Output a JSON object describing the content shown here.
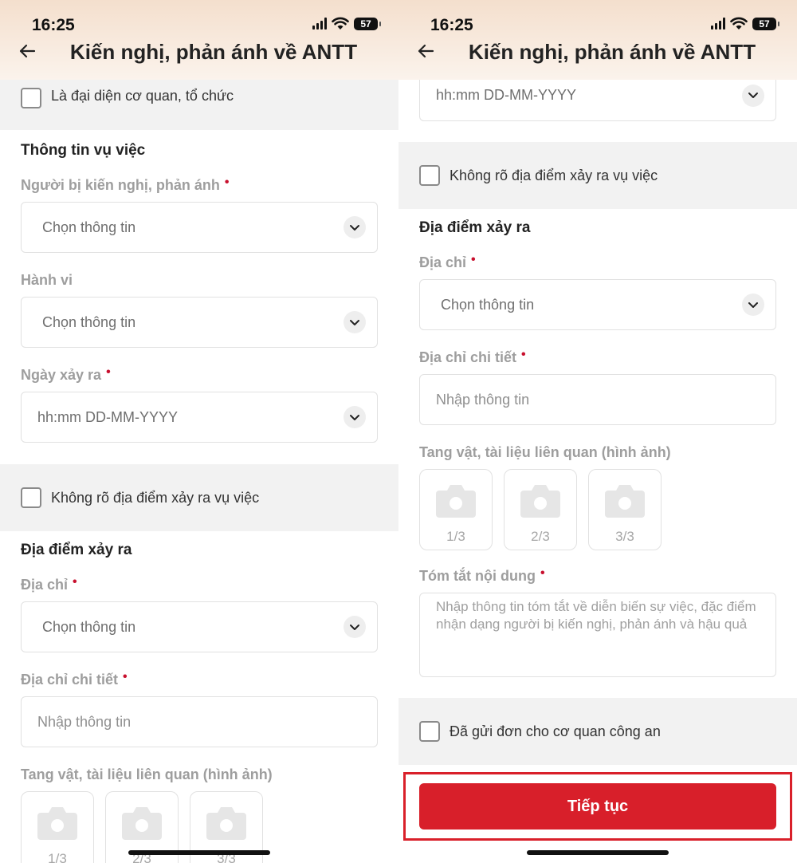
{
  "status_bar": {
    "time": "16:25",
    "battery": "57"
  },
  "header": {
    "title": "Kiến nghị, phản ánh về ANTT"
  },
  "form": {
    "representative_label": "Là đại diện cơ quan, tổ chức",
    "incident_section": "Thông tin vụ việc",
    "person_label": "Người bị kiến nghị, phản ánh",
    "behavior_label": "Hành vi",
    "date_label": "Ngày xảy ra",
    "select_placeholder": "Chọn thông tin",
    "date_placeholder": "hh:mm DD-MM-YYYY",
    "unknown_location_label": "Không rõ địa điểm xảy ra vụ việc",
    "location_section": "Địa điểm xảy ra",
    "address_label": "Địa chỉ",
    "address_detail_label": "Địa chỉ chi tiết",
    "input_placeholder": "Nhập thông tin",
    "evidence_label": "Tang vật, tài liệu liên quan (hình ảnh)",
    "photo_slots": [
      "1/3",
      "2/3",
      "3/3"
    ],
    "summary_label": "Tóm tắt nội dung",
    "summary_placeholder": "Nhập thông tin tóm tắt về diễn biến sự việc, đặc điểm nhận dạng người bị kiến nghị, phản ánh và hậu quả",
    "sent_label": "Đã gửi đơn cho cơ quan công an",
    "required_mark": "•",
    "submit_label": "Tiếp tục"
  },
  "colors": {
    "accent": "#d81f2a",
    "header_top": "#f4dfcd",
    "section_bg": "#f2f2f2"
  }
}
